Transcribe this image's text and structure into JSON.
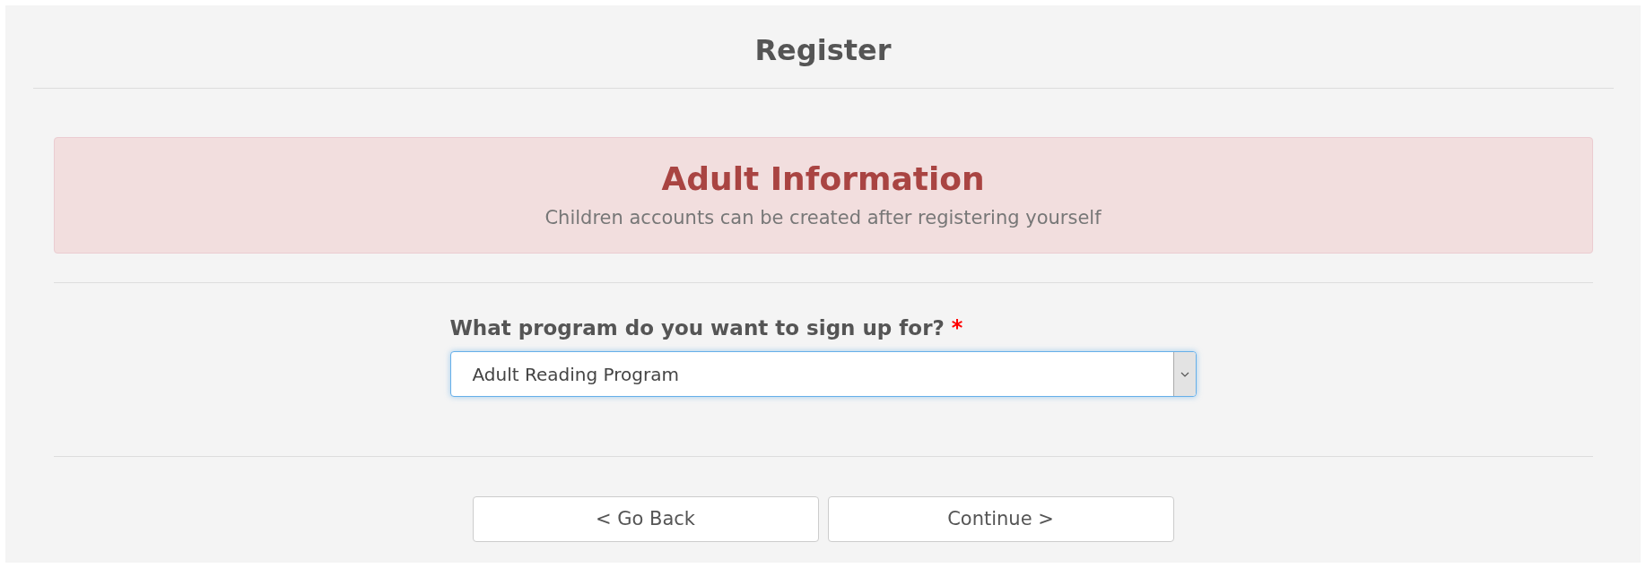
{
  "title": "Register",
  "notice": {
    "heading": "Adult Information",
    "text": "Children accounts can be created after registering yourself"
  },
  "program_field": {
    "label": "What program do you want to sign up for?",
    "required_mark": "*",
    "value": "Adult Reading Program",
    "focused": true
  },
  "buttons": [
    {
      "label": "< Go Back"
    },
    {
      "label": "Continue >"
    }
  ]
}
